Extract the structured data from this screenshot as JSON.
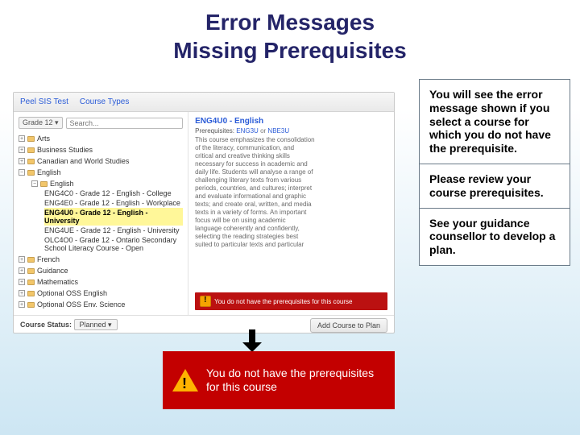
{
  "title_line1": "Error Messages",
  "title_line2": "Missing Prerequisites",
  "screenshot": {
    "breadcrumb1": "Peel SIS Test",
    "breadcrumb2": "Course Types",
    "grade_select": "Grade 12 ▾",
    "search_placeholder": "Search...",
    "tree": {
      "arts": "Arts",
      "business": "Business Studies",
      "canworld": "Canadian and World Studies",
      "english": "English",
      "eng_sub": "English",
      "eng1": "ENG4C0 - Grade 12 - English - College",
      "eng2": "ENG4E0 - Grade 12 - English - Workplace",
      "eng3_hi": "ENG4U0 - Grade 12 - English - University",
      "eng4": "ENG4UE - Grade 12 - English - University",
      "eng5": "OLC4O0 - Grade 12 - Ontario Secondary School Literacy Course - Open",
      "french": "French",
      "guidance": "Guidance",
      "math": "Mathematics",
      "oss": "Optional OSS English",
      "ossenv": "Optional OSS Env. Science"
    },
    "detail_title": "ENG4U0 - English",
    "prereq_label": "Prerequisites:",
    "prereq_link1": "ENG3U",
    "prereq_or": "or",
    "prereq_link2": "NBE3U",
    "desc_lines": [
      "This course emphasizes the consolidation",
      "of the literacy, communication, and",
      "critical and creative thinking skills",
      "necessary for success in academic and",
      "daily life. Students will analyse a range of",
      "challenging literary texts from various",
      "periods, countries, and cultures; interpret",
      "and evaluate informational and graphic",
      "texts; and create oral, written, and media",
      "texts in a variety of forms. An important",
      "focus will be on using academic",
      "language coherently and confidently,",
      "selecting the reading strategies best",
      "suited to particular texts and particular"
    ],
    "mini_err": "You do not have the prerequisites for this course",
    "status_label": "Course Status:",
    "status_value": "Planned ▾",
    "add_btn": "Add Course to Plan"
  },
  "big_error": {
    "line1": "You do not have the prerequisites",
    "line2": "for this course"
  },
  "boxes": {
    "b1": "You will see the error message shown if you select a course for which you do not have the prerequisite.",
    "b2": "Please review your course prerequisites.",
    "b3": "See your guidance counsellor to develop a plan."
  }
}
